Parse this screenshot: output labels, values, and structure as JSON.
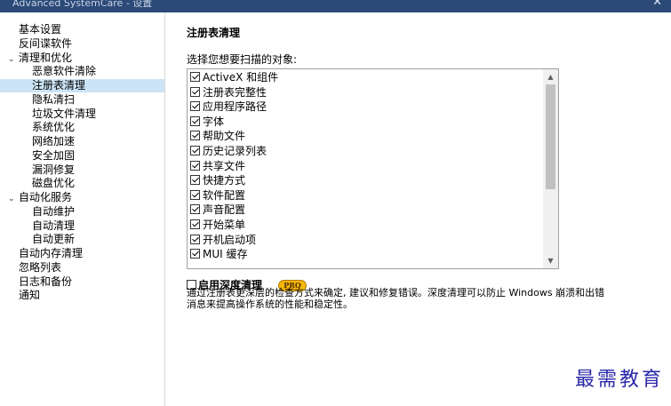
{
  "window": {
    "title": "Advanced SystemCare - 设置",
    "close_glyph": "✕"
  },
  "sidebar": {
    "items": [
      {
        "label": "基本设置",
        "level": 0,
        "arrow": ""
      },
      {
        "label": "反间谍软件",
        "level": 0,
        "arrow": ""
      },
      {
        "label": "清理和优化",
        "level": 0,
        "arrow": "⌄"
      },
      {
        "label": "恶意软件清除",
        "level": 1,
        "arrow": ""
      },
      {
        "label": "注册表清理",
        "level": 1,
        "arrow": "",
        "selected": true
      },
      {
        "label": "隐私清扫",
        "level": 1,
        "arrow": ""
      },
      {
        "label": "垃圾文件清理",
        "level": 1,
        "arrow": ""
      },
      {
        "label": "系统优化",
        "level": 1,
        "arrow": ""
      },
      {
        "label": "网络加速",
        "level": 1,
        "arrow": ""
      },
      {
        "label": "安全加固",
        "level": 1,
        "arrow": ""
      },
      {
        "label": "漏洞修复",
        "level": 1,
        "arrow": ""
      },
      {
        "label": "磁盘优化",
        "level": 1,
        "arrow": ""
      },
      {
        "label": "自动化服务",
        "level": 0,
        "arrow": "⌄"
      },
      {
        "label": "自动维护",
        "level": 1,
        "arrow": ""
      },
      {
        "label": "自动清理",
        "level": 1,
        "arrow": ""
      },
      {
        "label": "自动更新",
        "level": 1,
        "arrow": ""
      },
      {
        "label": "自动内存清理",
        "level": 0,
        "arrow": ""
      },
      {
        "label": "忽略列表",
        "level": 0,
        "arrow": ""
      },
      {
        "label": "日志和备份",
        "level": 0,
        "arrow": ""
      },
      {
        "label": "通知",
        "level": 0,
        "arrow": ""
      }
    ]
  },
  "main": {
    "title": "注册表清理",
    "select_label": "选择您想要扫描的对象:",
    "scan_items": [
      {
        "label": "ActiveX 和组件",
        "checked": true
      },
      {
        "label": "注册表完整性",
        "checked": true
      },
      {
        "label": "应用程序路径",
        "checked": true
      },
      {
        "label": "字体",
        "checked": true
      },
      {
        "label": "帮助文件",
        "checked": true
      },
      {
        "label": "历史记录列表",
        "checked": true
      },
      {
        "label": "共享文件",
        "checked": true
      },
      {
        "label": "快捷方式",
        "checked": true
      },
      {
        "label": "软件配置",
        "checked": true
      },
      {
        "label": "声音配置",
        "checked": true
      },
      {
        "label": "开始菜单",
        "checked": true
      },
      {
        "label": "开机启动项",
        "checked": true
      },
      {
        "label": "MUI 缓存",
        "checked": true
      }
    ],
    "deep_clean": {
      "label": "启用深度清理",
      "checked": false,
      "badge": "PRO"
    },
    "description": "通过注册表更深层的检查方式来确定, 建议和修复错误。深度清理可以防止 Windows 崩溃和出错消息来提高操作系统的性能和稳定性。"
  },
  "watermark": "最需教育"
}
